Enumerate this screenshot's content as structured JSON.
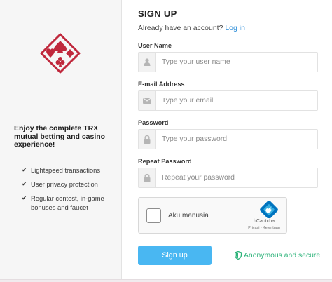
{
  "left": {
    "tagline": "Enjoy the complete TRX mutual betting and casino experience!",
    "features": [
      "Lightspeed transactions",
      "User privacy protection",
      "Regular contest, in-game bonuses and faucet"
    ],
    "logo_icon": "card-suits-logo",
    "brand_color": "#c0283c"
  },
  "form": {
    "title": "SIGN UP",
    "have_account": "Already have an account?",
    "login_link": "Log in",
    "fields": [
      {
        "label": "User Name",
        "placeholder": "Type your user name",
        "icon": "user-icon"
      },
      {
        "label": "E-mail Address",
        "placeholder": "Type your email",
        "icon": "envelope-icon"
      },
      {
        "label": "Password",
        "placeholder": "Type your password",
        "icon": "lock-icon"
      },
      {
        "label": "Repeat Password",
        "placeholder": "Repeat your password",
        "icon": "lock-icon"
      }
    ],
    "captcha": {
      "label": "Aku manusia",
      "brand": "hCaptcha",
      "links": "Privasi - Ketentuan"
    },
    "submit_label": "Sign up",
    "secure_text": "Anonymous and secure",
    "accent_color": "#49b7f2",
    "secure_color": "#2db37a"
  }
}
